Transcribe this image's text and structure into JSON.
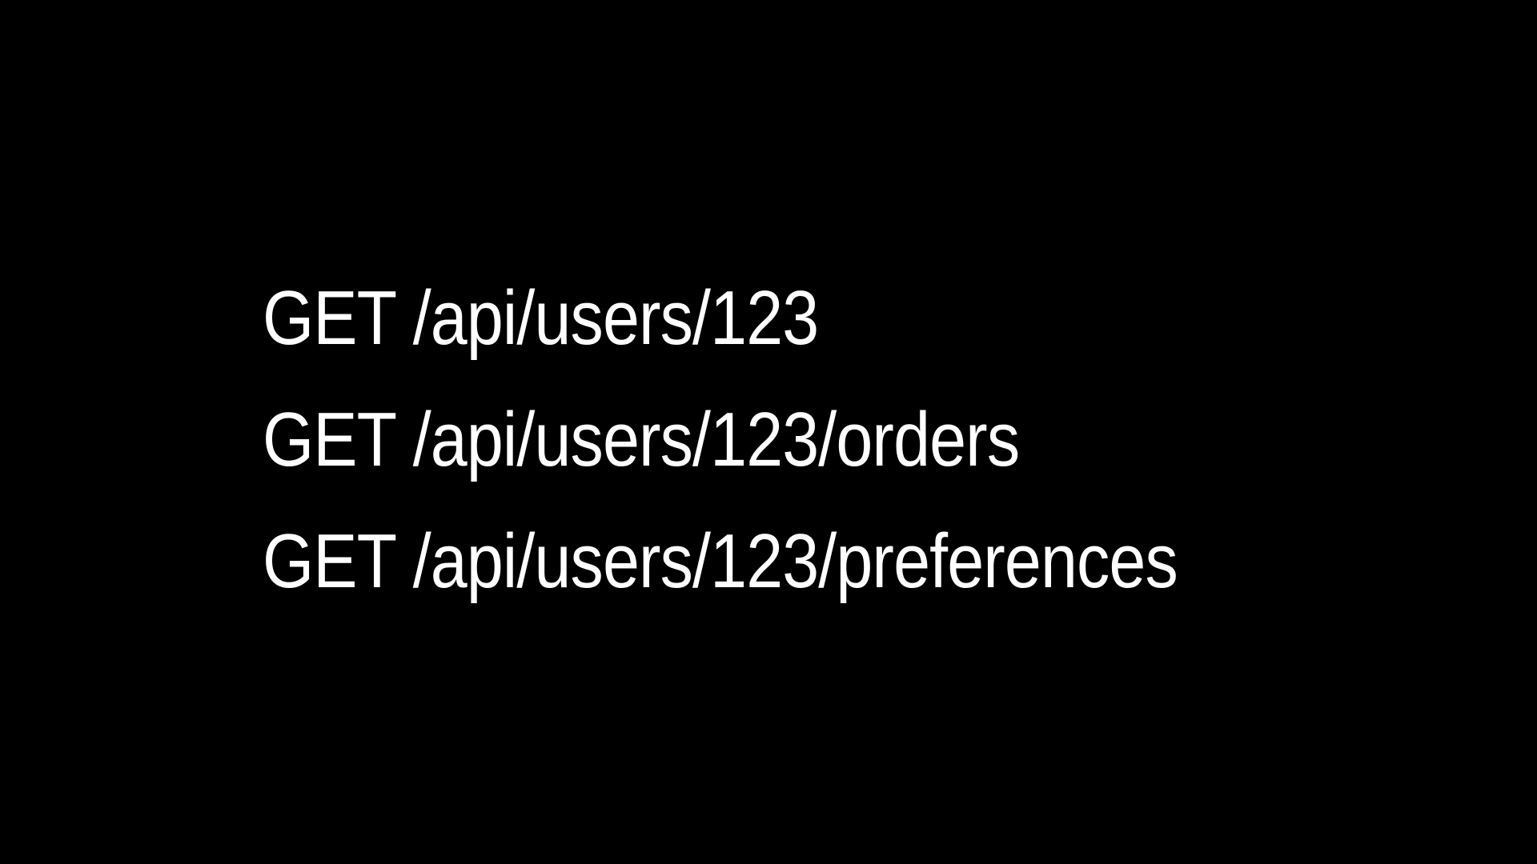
{
  "slide": {
    "background_color": "#000000",
    "text_color": "#ffffff",
    "lines": [
      "GET /api/users/123",
      "GET /api/users/123/orders",
      "GET /api/users/123/preferences"
    ]
  }
}
